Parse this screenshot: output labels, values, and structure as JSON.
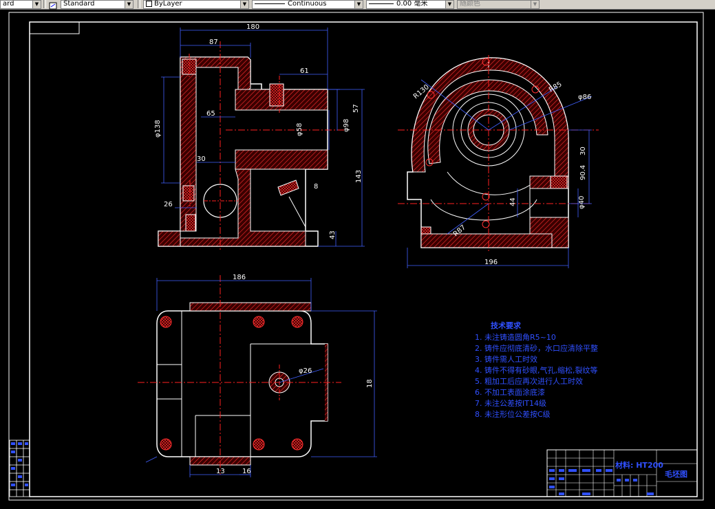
{
  "toolbar": {
    "text_style": "ard",
    "dim_style": "Standard",
    "layer": "ByLayer",
    "linetype": "Continuous",
    "lineweight": "0.00 毫米",
    "color": "随颜色"
  },
  "drawing": {
    "front_view": {
      "dims": [
        "180",
        "87",
        "61",
        "57",
        "65",
        "φ138",
        "φ58",
        "φ98",
        "30",
        "26",
        "143",
        "43",
        "8"
      ]
    },
    "side_view": {
      "dims": [
        "R130",
        "R85",
        "φ86",
        "30",
        "90.4",
        "44",
        "φ40",
        "R87",
        "196"
      ]
    },
    "top_view": {
      "dims": [
        "186",
        "φ26",
        "18",
        "13",
        "16"
      ]
    },
    "tech_requirements": {
      "title": "技术要求",
      "items": [
        "1. 未注铸造圆角R5~10",
        "2. 铸件应彻底清砂，水口应清除平整",
        "3. 铸件需人工时效",
        "4. 铸件不得有砂眼,气孔,缩松,裂纹等",
        "5. 粗加工后应再次进行人工时效",
        "6. 不加工表面涂底漆",
        "7. 未注公差按IT14级",
        "8. 未注形位公差按C级"
      ]
    },
    "title_block": {
      "material": "材料: HT200",
      "name": "毛坯图"
    }
  }
}
